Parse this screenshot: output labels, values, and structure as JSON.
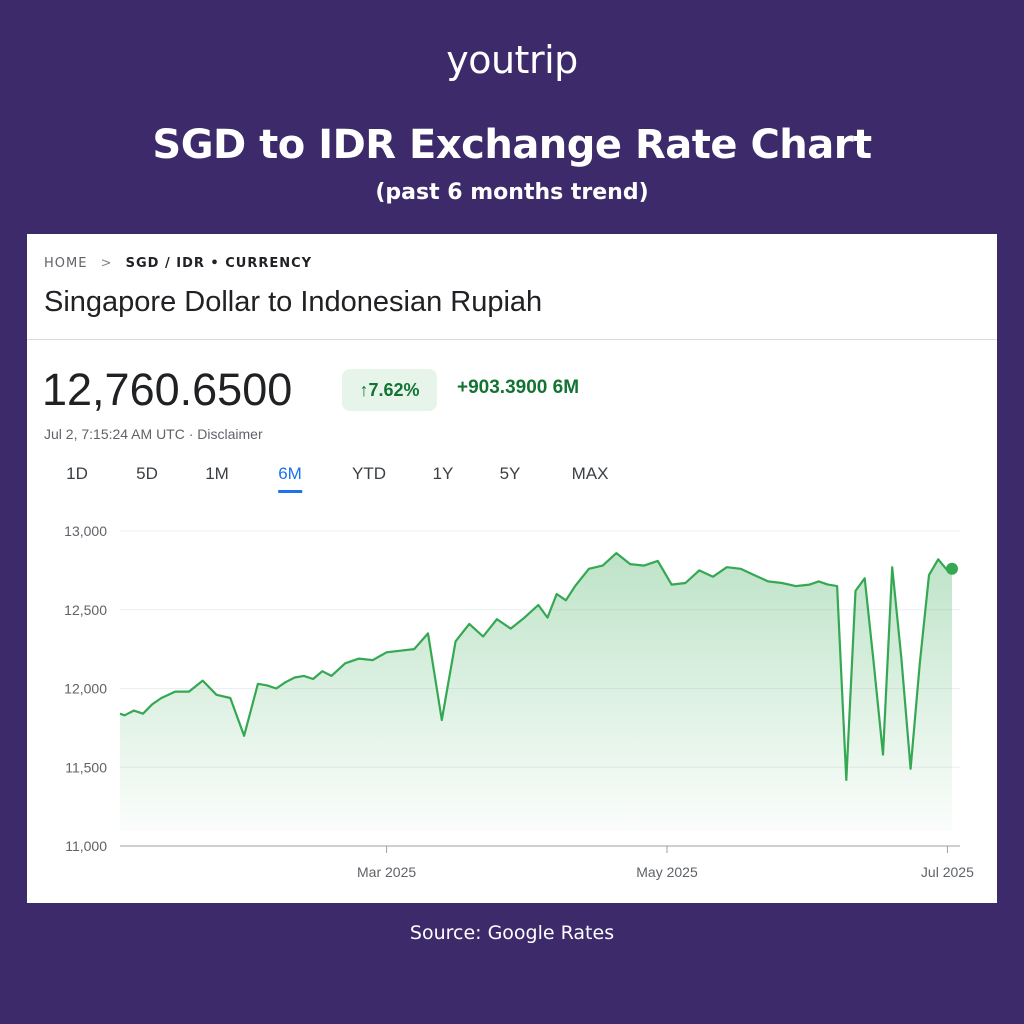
{
  "header": {
    "logo_text": "youtrip",
    "title": "SGD to IDR Exchange Rate Chart",
    "subtitle": "(past 6 months trend)"
  },
  "card": {
    "breadcrumb": {
      "home": "HOME",
      "separator": ">",
      "current": "SGD / IDR • CURRENCY"
    },
    "title": "Singapore Dollar to Indonesian Rupiah",
    "price": "12,760.6500",
    "change_pill": "↑7.62%",
    "change_abs": "+903.3900 6M",
    "timestamp": "Jul 2, 7:15:24 AM UTC · Disclaimer",
    "ranges": [
      {
        "label": "1D",
        "active": false
      },
      {
        "label": "5D",
        "active": false
      },
      {
        "label": "1M",
        "active": false
      },
      {
        "label": "6M",
        "active": true
      },
      {
        "label": "YTD",
        "active": false
      },
      {
        "label": "1Y",
        "active": false
      },
      {
        "label": "5Y",
        "active": false
      },
      {
        "label": "MAX",
        "active": false
      }
    ]
  },
  "colors": {
    "background": "#3d2a6b",
    "line": "#34a853",
    "positive": "#137333",
    "active_tab": "#1a73e8"
  },
  "chart_data": {
    "type": "area",
    "title": "",
    "xlabel": "",
    "ylabel": "",
    "ylim": [
      11000,
      13000
    ],
    "yticks": [
      11000,
      11500,
      12000,
      12500,
      13000
    ],
    "ytick_labels": [
      "11,000",
      "11,500",
      "12,000",
      "12,500",
      "13,000"
    ],
    "xticks": [
      "2025-03-01",
      "2025-05-01",
      "2025-07-01"
    ],
    "xtick_labels": [
      "Mar 2025",
      "May 2025",
      "Jul 2025"
    ],
    "grid": true,
    "series": [
      {
        "x": [
          "2025-01-02",
          "2025-01-03",
          "2025-01-05",
          "2025-01-07",
          "2025-01-09",
          "2025-01-11",
          "2025-01-14",
          "2025-01-17",
          "2025-01-20",
          "2025-01-23",
          "2025-01-26",
          "2025-01-29",
          "2025-02-01",
          "2025-02-03",
          "2025-02-05",
          "2025-02-07",
          "2025-02-09",
          "2025-02-11",
          "2025-02-13",
          "2025-02-15",
          "2025-02-17",
          "2025-02-20",
          "2025-02-23",
          "2025-02-26",
          "2025-03-01",
          "2025-03-04",
          "2025-03-07",
          "2025-03-10",
          "2025-03-13",
          "2025-03-16",
          "2025-03-19",
          "2025-03-22",
          "2025-03-25",
          "2025-03-28",
          "2025-03-31",
          "2025-04-03",
          "2025-04-05",
          "2025-04-07",
          "2025-04-09",
          "2025-04-11",
          "2025-04-14",
          "2025-04-17",
          "2025-04-20",
          "2025-04-23",
          "2025-04-26",
          "2025-04-29",
          "2025-05-02",
          "2025-05-05",
          "2025-05-08",
          "2025-05-11",
          "2025-05-14",
          "2025-05-17",
          "2025-05-20",
          "2025-05-23",
          "2025-05-26",
          "2025-05-29",
          "2025-06-01",
          "2025-06-03",
          "2025-06-05",
          "2025-06-07",
          "2025-06-09",
          "2025-06-11",
          "2025-06-13",
          "2025-06-15",
          "2025-06-17",
          "2025-06-19",
          "2025-06-21",
          "2025-06-23",
          "2025-06-25",
          "2025-06-27",
          "2025-06-29",
          "2025-07-01",
          "2025-07-02"
        ],
        "values": [
          11840,
          11830,
          11860,
          11840,
          11900,
          11940,
          11980,
          11980,
          12050,
          11960,
          11940,
          11700,
          12030,
          12020,
          12000,
          12040,
          12070,
          12080,
          12060,
          12110,
          12080,
          12160,
          12190,
          12180,
          12230,
          12240,
          12250,
          12350,
          11800,
          12300,
          12410,
          12330,
          12440,
          12380,
          12450,
          12530,
          12450,
          12600,
          12560,
          12650,
          12760,
          12780,
          12860,
          12790,
          12780,
          12810,
          12660,
          12670,
          12750,
          12710,
          12770,
          12760,
          12720,
          12680,
          12670,
          12650,
          12660,
          12680,
          12660,
          12650,
          11420,
          12620,
          12700,
          12150,
          11580,
          12770,
          12190,
          11490,
          12160,
          12720,
          12820,
          12750,
          12760
        ]
      }
    ]
  },
  "footer": {
    "source": "Source: Google Rates"
  }
}
